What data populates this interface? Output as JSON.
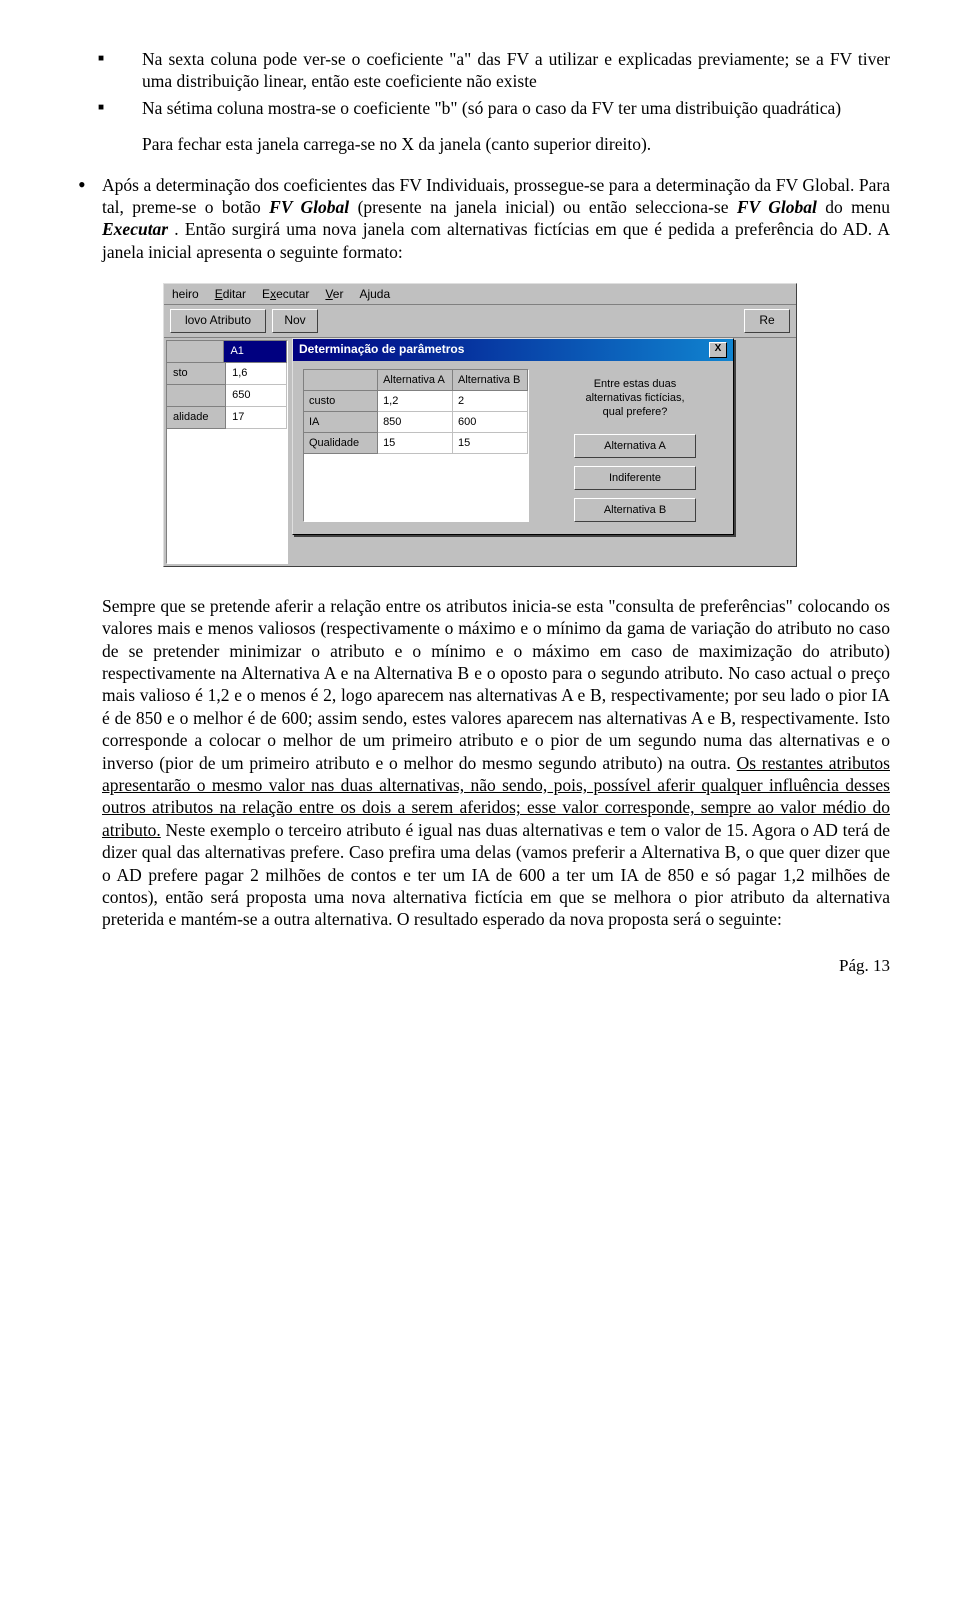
{
  "bullets": {
    "b1": "Na sexta coluna pode ver-se o coeficiente \"a\" das FV a utilizar e explicadas previamente; se a FV tiver uma distribuição linear, então este coeficiente não existe",
    "b2": "Na sétima coluna mostra-se o coeficiente \"b\" (só para o caso da FV ter uma distribuição quadrática)"
  },
  "sub_para": "Para fechar esta janela carrega-se no X da janela (canto superior direito).",
  "dot_para_pre": "Após a determinação dos coeficientes das FV Individuais, prossegue-se para a determinação da FV Global. Para tal, preme-se o botão ",
  "dot_fvglobal1": "FV Global",
  "dot_para_mid": " (presente na janela inicial) ou então selecciona-se ",
  "dot_fvglobal2": "FV Global",
  "dot_para_mid2": " do menu ",
  "dot_executar": "Executar",
  "dot_para_end": ". Então surgirá uma nova janela com alternativas fictícias em que é pedida a preferência do AD. A janela inicial apresenta o seguinte formato:",
  "screenshot": {
    "menu": {
      "ficheiro": "heiro",
      "editar": "Editar",
      "executar": "Executar",
      "ver": "Ver",
      "ajuda": "Ajuda"
    },
    "toolbar": {
      "novo_atr": "lovo Atributo",
      "nov": "Nov",
      "re": "Re"
    },
    "leftgrid": {
      "hdr": "A1",
      "rows": [
        {
          "label": "sto",
          "val": "1,6"
        },
        {
          "label": "",
          "val": "650"
        },
        {
          "label": "alidade",
          "val": "17"
        }
      ]
    },
    "dialog": {
      "title": "Determinação de parâmetros",
      "colA": "Alternativa A",
      "colB": "Alternativa B",
      "rows": [
        {
          "name": "custo",
          "a": "1,2",
          "b": "2"
        },
        {
          "name": "IA",
          "a": "850",
          "b": "600"
        },
        {
          "name": "Qualidade",
          "a": "15",
          "b": "15"
        }
      ],
      "msg1": "Entre estas duas",
      "msg2": "alternativas fictícias,",
      "msg3": "qual prefere?",
      "btnA": "Alternativa A",
      "btnI": "Indiferente",
      "btnB": "Alternativa B",
      "close": "X"
    }
  },
  "body_text": {
    "p1a": "Sempre que se pretende aferir a relação entre os atributos inicia-se esta \"consulta de preferências\" colocando os valores mais e menos valiosos (respectivamente o máximo e o mínimo da gama de variação do atributo no caso de se pretender minimizar o atributo e o mínimo e o máximo em caso de maximização do atributo) respectivamente na Alternativa A e na Alternativa B e o oposto para o segundo atributo. No caso actual o preço mais valioso é 1,2 e o menos é 2, logo aparecem nas alternativas A e B, respectivamente; por seu lado o pior IA é de 850 e o melhor é de 600; assim sendo, estes valores aparecem nas alternativas A e B, respectivamente. Isto corresponde a colocar o melhor de um primeiro atributo e o pior de um segundo numa das alternativas e o inverso (pior de um primeiro atributo e o melhor do mesmo segundo atributo) na outra. ",
    "p1u": "Os restantes atributos apresentarão o mesmo valor nas duas alternativas, não sendo, pois, possível aferir qualquer influência desses outros atributos na relação entre os dois a serem aferidos; esse valor corresponde, sempre ao valor médio do atributo.",
    "p1b": " Neste exemplo o terceiro atributo é igual nas duas alternativas e tem o valor de 15. Agora o AD terá de dizer qual das alternativas prefere. Caso prefira uma delas (vamos preferir a Alternativa B, o que quer dizer que o AD prefere pagar 2 milhões de contos e ter um IA de 600 a ter um IA de 850 e só pagar 1,2 milhões de contos), então será proposta uma nova alternativa fictícia em que se melhora o pior atributo da alternativa preterida e mantém-se a outra alternativa. O resultado esperado da nova proposta será o seguinte:"
  },
  "page_num": "Pág. 13"
}
